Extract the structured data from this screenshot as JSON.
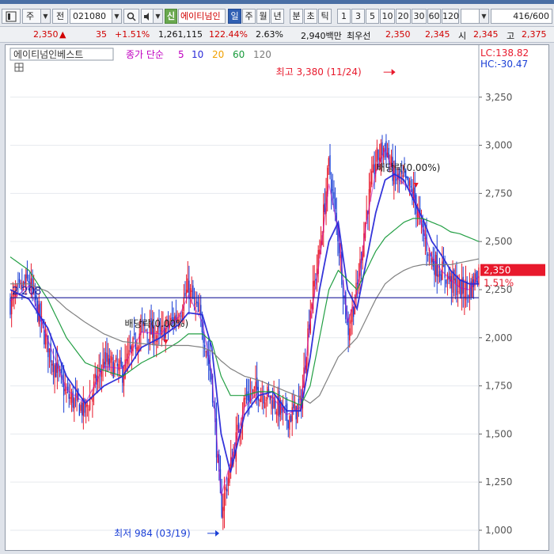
{
  "toolbar": {
    "market": "주",
    "prev_label": "전",
    "code": "021080",
    "badge": "신",
    "stock_name": "에이티넘인",
    "periods": [
      "일",
      "주",
      "월",
      "년",
      "분",
      "초",
      "틱"
    ],
    "active_period": "일",
    "intervals": [
      "1",
      "3",
      "5",
      "10",
      "20",
      "30",
      "60",
      "120"
    ],
    "count": "416",
    "count_max": "/600"
  },
  "quote": {
    "price": "2,350",
    "change": "35",
    "change_pct": "+1.51%",
    "volume": "1,261,115",
    "vol_ratio": "122.44%",
    "turnover": "2.63%",
    "amount": "2,940백만",
    "best_label": "최우선",
    "best_ask": "2,350",
    "best_bid": "2,345",
    "open_label": "시",
    "open": "2,345",
    "high_label": "고",
    "high": "2,375"
  },
  "chart_data": {
    "type": "line",
    "subtype": "candlestick-with-moving-averages",
    "legend": {
      "title": "에이티넘인베스트",
      "ma_label": "종가 단순",
      "ma_periods": [
        "5",
        "10",
        "20",
        "60",
        "120"
      ],
      "ma_colors": [
        "#c000c0",
        "#2a2ad8",
        "#f0a000",
        "#179a3a",
        "#7a7a7a"
      ]
    },
    "lc_label": "LC:138.82",
    "hc_label": "HC:-30.47",
    "ylim": [
      930,
      3430
    ],
    "yticks": [
      1000,
      1250,
      1500,
      1750,
      2000,
      2250,
      2500,
      2750,
      3000,
      3250
    ],
    "ytick_labels": [
      "1,000",
      "1,250",
      "1,500",
      "1,750",
      "2,000",
      "2,250",
      "2,500",
      "2,750",
      "3,000",
      "3,250"
    ],
    "reference_line": {
      "value": 2208,
      "label": "2,208"
    },
    "current": {
      "value": 2350,
      "label": "2,350",
      "pct": "1.51%"
    },
    "annotations": [
      {
        "text": "최고 3,380 (11/24)",
        "value": 3380,
        "position": 0.817
      },
      {
        "text": "최저 984 (03/19)",
        "value": 984,
        "position": 0.441
      },
      {
        "text": "배당락(0.00%)",
        "position": 0.332
      },
      {
        "text": "배당락(0.00%)",
        "position": 0.866
      }
    ],
    "series": [
      {
        "name": "close",
        "x": [
          0,
          0.04,
          0.08,
          0.12,
          0.16,
          0.2,
          0.24,
          0.28,
          0.32,
          0.36,
          0.38,
          0.41,
          0.43,
          0.45,
          0.47,
          0.5,
          0.53,
          0.56,
          0.59,
          0.62,
          0.64,
          0.66,
          0.68,
          0.7,
          0.72,
          0.74,
          0.76,
          0.78,
          0.8,
          0.82,
          0.84,
          0.86,
          0.88,
          0.9,
          0.92,
          0.94,
          0.96,
          0.98,
          1
        ],
        "values": [
          2180,
          2300,
          1950,
          1700,
          1620,
          1880,
          1820,
          2050,
          2010,
          2130,
          2260,
          2060,
          1780,
          1100,
          1330,
          1680,
          1730,
          1680,
          1580,
          1650,
          2150,
          2450,
          2900,
          2520,
          2030,
          2250,
          2650,
          2920,
          3000,
          2830,
          2810,
          2750,
          2550,
          2400,
          2350,
          2300,
          2250,
          2250,
          2350
        ]
      },
      {
        "name": "MA5",
        "x": [
          0,
          0.04,
          0.08,
          0.12,
          0.16,
          0.2,
          0.24,
          0.28,
          0.32,
          0.36,
          0.38,
          0.41,
          0.43,
          0.45,
          0.47,
          0.5,
          0.53,
          0.56,
          0.59,
          0.62,
          0.64,
          0.66,
          0.68,
          0.7,
          0.72,
          0.74,
          0.76,
          0.78,
          0.8,
          0.82,
          0.84,
          0.86,
          0.88,
          0.9,
          0.92,
          0.94,
          0.96,
          0.98,
          1
        ],
        "values": [
          2190,
          2270,
          1990,
          1730,
          1660,
          1850,
          1840,
          2030,
          2020,
          2110,
          2220,
          2080,
          1820,
          1180,
          1350,
          1640,
          1720,
          1690,
          1600,
          1640,
          2080,
          2400,
          2800,
          2560,
          2080,
          2230,
          2600,
          2860,
          2980,
          2840,
          2800,
          2750,
          2570,
          2420,
          2350,
          2300,
          2260,
          2250,
          2320
        ]
      },
      {
        "name": "MA20",
        "x": [
          0,
          0.04,
          0.08,
          0.12,
          0.16,
          0.2,
          0.24,
          0.28,
          0.32,
          0.36,
          0.38,
          0.41,
          0.43,
          0.45,
          0.47,
          0.5,
          0.53,
          0.56,
          0.59,
          0.62,
          0.64,
          0.66,
          0.68,
          0.7,
          0.72,
          0.74,
          0.76,
          0.78,
          0.8,
          0.82,
          0.84,
          0.86,
          0.88,
          0.9,
          0.92,
          0.94,
          0.96,
          0.98,
          1
        ],
        "values": [
          2250,
          2200,
          2050,
          1800,
          1660,
          1750,
          1800,
          1950,
          2000,
          2070,
          2130,
          2120,
          1950,
          1500,
          1300,
          1600,
          1700,
          1720,
          1620,
          1620,
          1900,
          2250,
          2500,
          2600,
          2250,
          2150,
          2400,
          2650,
          2820,
          2850,
          2820,
          2720,
          2620,
          2500,
          2430,
          2350,
          2300,
          2280,
          2280
        ]
      },
      {
        "name": "MA60",
        "x": [
          0,
          0.04,
          0.08,
          0.12,
          0.16,
          0.2,
          0.24,
          0.28,
          0.32,
          0.36,
          0.38,
          0.41,
          0.43,
          0.45,
          0.47,
          0.5,
          0.53,
          0.56,
          0.59,
          0.62,
          0.64,
          0.66,
          0.68,
          0.7,
          0.72,
          0.74,
          0.76,
          0.78,
          0.8,
          0.82,
          0.84,
          0.86,
          0.88,
          0.9,
          0.92,
          0.94,
          0.96,
          0.98,
          1
        ],
        "values": [
          2420,
          2350,
          2200,
          2000,
          1870,
          1830,
          1800,
          1870,
          1920,
          1980,
          2020,
          2020,
          1980,
          1800,
          1700,
          1700,
          1720,
          1720,
          1680,
          1650,
          1750,
          2000,
          2250,
          2350,
          2300,
          2250,
          2350,
          2450,
          2520,
          2560,
          2600,
          2620,
          2620,
          2600,
          2580,
          2550,
          2540,
          2520,
          2500
        ]
      },
      {
        "name": "MA120",
        "x": [
          0,
          0.04,
          0.08,
          0.12,
          0.16,
          0.2,
          0.24,
          0.28,
          0.32,
          0.36,
          0.38,
          0.41,
          0.43,
          0.45,
          0.47,
          0.5,
          0.53,
          0.56,
          0.59,
          0.62,
          0.64,
          0.66,
          0.68,
          0.7,
          0.72,
          0.74,
          0.76,
          0.78,
          0.8,
          0.82,
          0.84,
          0.86,
          0.88,
          0.9,
          0.92,
          0.94,
          0.96,
          0.98,
          1
        ],
        "values": [
          2280,
          2280,
          2240,
          2150,
          2080,
          2020,
          1980,
          1970,
          1960,
          1960,
          1960,
          1950,
          1930,
          1880,
          1840,
          1800,
          1780,
          1750,
          1720,
          1690,
          1660,
          1700,
          1800,
          1900,
          1950,
          2000,
          2100,
          2200,
          2280,
          2320,
          2350,
          2370,
          2380,
          2380,
          2380,
          2380,
          2390,
          2400,
          2410
        ]
      }
    ]
  }
}
